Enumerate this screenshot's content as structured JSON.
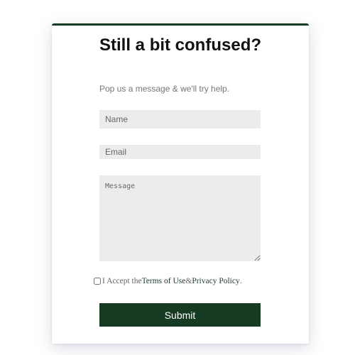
{
  "contact_card": {
    "title": "Still a bit confused?",
    "subtitle": "Pop us a message & we'll try help.",
    "fields": {
      "name_placeholder": "Name",
      "email_placeholder": "Email",
      "message_placeholder": "Message"
    },
    "consent": {
      "prefix": "I Accept the ",
      "terms_link": "Terms of Use",
      "joiner": " & ",
      "privacy_link": "Privacy Policy",
      "suffix": "."
    },
    "submit_label": "Submit"
  },
  "colors": {
    "accent": "#173a22",
    "field_background": "#ececec",
    "subtitle_text": "#777777"
  }
}
